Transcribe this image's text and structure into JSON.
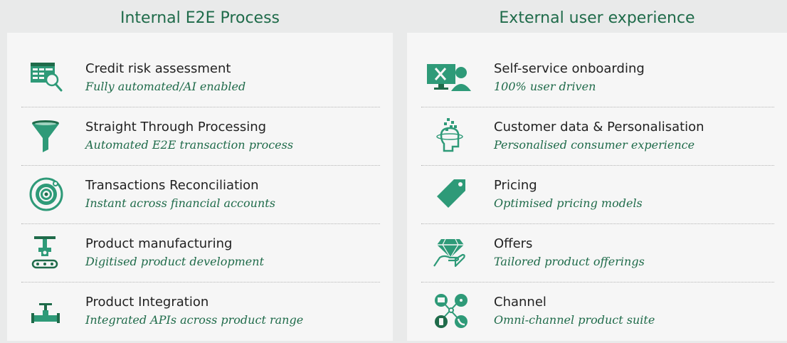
{
  "colors": {
    "accent": "#1f6b4a",
    "icon": "#2e9a78",
    "panel_bg": "#f6f6f6",
    "page_bg": "#e9eaea"
  },
  "left": {
    "heading": "Internal E2E Process",
    "items": [
      {
        "title": "Credit risk assessment",
        "sub": "Fully automated/AI enabled",
        "icon": "document-magnifier-icon"
      },
      {
        "title": "Straight Through Processing",
        "sub": "Automated E2E transaction process",
        "icon": "funnel-icon"
      },
      {
        "title": "Transactions Reconciliation",
        "sub": "Instant across financial accounts",
        "icon": "target-circle-icon"
      },
      {
        "title": "Product manufacturing",
        "sub": "Digitised product development",
        "icon": "robot-arm-conveyor-icon"
      },
      {
        "title": "Product Integration",
        "sub": "Integrated APIs across product range",
        "icon": "pipe-valve-icon"
      }
    ]
  },
  "right": {
    "heading": "External user experience",
    "items": [
      {
        "title": "Self-service onboarding",
        "sub": "100% user driven",
        "icon": "monitor-user-tools-icon"
      },
      {
        "title": "Customer data & Personalisation",
        "sub": "Personalised consumer experience",
        "icon": "head-data-icon"
      },
      {
        "title": "Pricing",
        "sub": "Optimised pricing models",
        "icon": "price-tag-icon"
      },
      {
        "title": "Offers",
        "sub": "Tailored product offerings",
        "icon": "hand-gem-icon"
      },
      {
        "title": "Channel",
        "sub": "Omni-channel product suite",
        "icon": "channel-network-icon"
      }
    ]
  }
}
